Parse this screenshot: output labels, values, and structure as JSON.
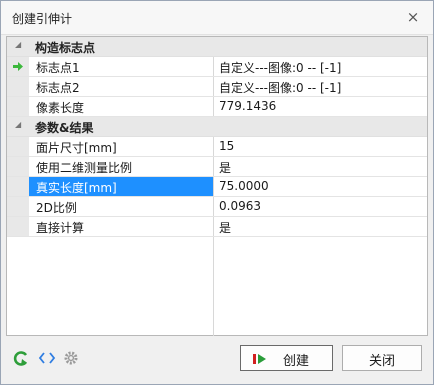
{
  "window": {
    "title": "创建引伸计",
    "close_glyph": "×"
  },
  "sections": [
    {
      "label": "构造标志点",
      "rows": [
        {
          "name": "标志点1",
          "value": "自定义---图像:0 -- [-1]",
          "active": true
        },
        {
          "name": "标志点2",
          "value": "自定义---图像:0 -- [-1]"
        },
        {
          "name": "像素长度",
          "value": "779.1436"
        }
      ]
    },
    {
      "label": "参数&结果",
      "rows": [
        {
          "name": "面片尺寸[mm]",
          "value": "15"
        },
        {
          "name": "使用二维测量比例",
          "value": "是"
        },
        {
          "name": "真实长度[mm]",
          "value": "75.0000",
          "selected": true
        },
        {
          "name": "2D比例",
          "value": "0.0963"
        },
        {
          "name": "直接计算",
          "value": "是"
        }
      ]
    }
  ],
  "footer": {
    "create_label": "创建",
    "close_label": "关闭",
    "icons": [
      "undo-arrow-icon",
      "code-brackets-icon",
      "gear-icon"
    ]
  },
  "colors": {
    "selection": "#1e90ff",
    "active_arrow": "#3cb83c",
    "play_icon": "#2a9d3a",
    "stop_icon": "#d12020",
    "undo_icon": "#2e9e3a",
    "brackets_icon": "#2f7de1"
  }
}
